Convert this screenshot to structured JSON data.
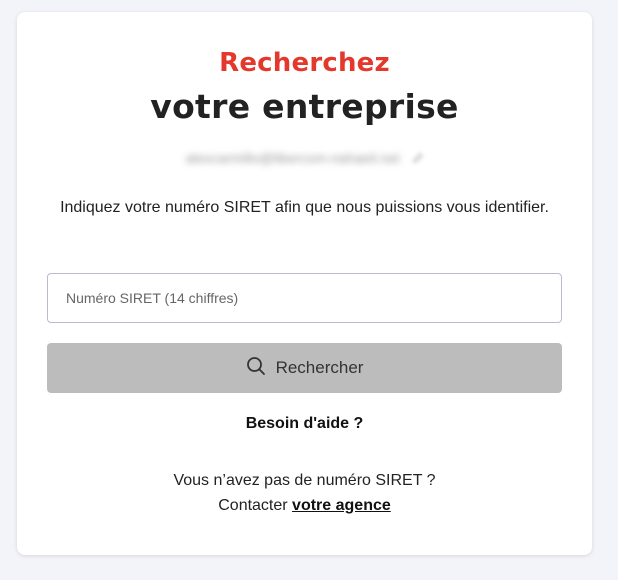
{
  "header": {
    "title_accent": "Recherchez",
    "title_main": "votre entreprise"
  },
  "account": {
    "email": "alexcarmillo@libercom-nahaeil.net",
    "edit_icon": "pencil-icon"
  },
  "instruction": "Indiquez votre numéro SIRET afin que nous puissions vous identifier.",
  "form": {
    "siret_placeholder": "Numéro SIRET (14 chiffres)",
    "siret_value": "",
    "search_label": "Rechercher",
    "search_icon": "search-icon"
  },
  "help": {
    "label": "Besoin d'aide ?"
  },
  "no_siret": {
    "question": "Vous n’avez pas de numéro SIRET ?",
    "contact_prefix": "Contacter ",
    "contact_link": "votre agence"
  },
  "colors": {
    "accent": "#e4382c",
    "button_disabled": "#bcbcbc",
    "background": "#f3f4f9"
  }
}
